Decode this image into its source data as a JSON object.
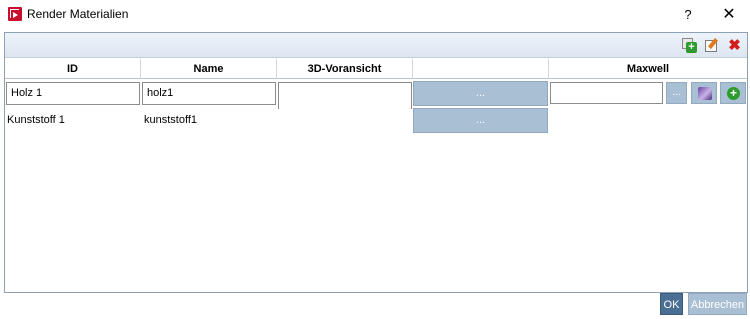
{
  "window": {
    "title": "Render Materialien",
    "help_label": "?",
    "close_label": "✕"
  },
  "toolbar": {
    "add_icon": "add-record-icon",
    "edit_icon": "edit-record-icon",
    "delete_icon": "delete-icon",
    "delete_glyph": "✖"
  },
  "table": {
    "columns": [
      "ID",
      "Name",
      "3D-Voransicht",
      "",
      "Maxwell"
    ],
    "rows": [
      {
        "id": "Holz 1",
        "name": "holz1",
        "preview": "",
        "action_label": "...",
        "maxwell": "",
        "maxwell_browse_label": "..."
      },
      {
        "id": "Kunststoff 1",
        "name": "kunststoff1",
        "preview": "",
        "action_label": "..."
      }
    ]
  },
  "footer": {
    "ok_label": "OK",
    "cancel_label": "Abbrechen"
  },
  "colors": {
    "accent_button": "#a9bfd4",
    "ok_button": "#4a6f93",
    "delete_red": "#d11c1c",
    "add_green": "#2e9b2e"
  }
}
